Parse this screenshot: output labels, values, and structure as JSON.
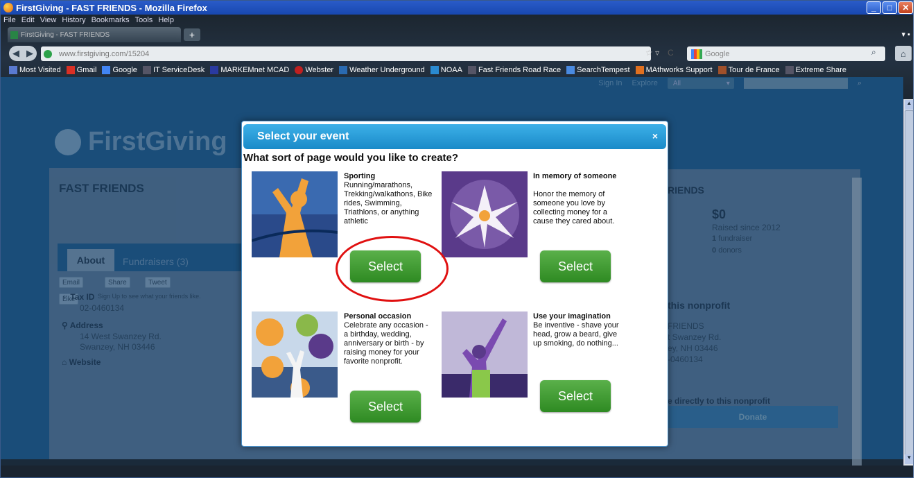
{
  "window": {
    "title": "FirstGiving - FAST FRIENDS - Mozilla Firefox"
  },
  "menu": [
    "File",
    "Edit",
    "View",
    "History",
    "Bookmarks",
    "Tools",
    "Help"
  ],
  "tab": {
    "title": "FirstGiving - FAST FRIENDS"
  },
  "nav": {
    "url_domain": "www.firstgiving.com",
    "url_path": "/15204",
    "search_placeholder": "Google"
  },
  "bookmarks": [
    "Most Visited",
    "Gmail",
    "Google",
    "IT ServiceDesk",
    "MARKEMnet MCAD",
    "Webster",
    "Weather Underground",
    "NOAA",
    "Fast Friends Road Race",
    "SearchTempest",
    "MAthworks Support",
    "Tour de France",
    "Extreme Share"
  ],
  "site": {
    "topnav": {
      "signin": "Sign In",
      "explore": "Explore",
      "all": "All"
    },
    "logo": "FirstGiving",
    "org_title": "FAST FRIENDS",
    "share": {
      "email": "Email",
      "share": "Share",
      "tweet": "Tweet",
      "like": "Like",
      "signup": "Sign Up to see what your friends like."
    },
    "tabs": {
      "about": "About",
      "fundraisers": "Fundraisers (3)"
    },
    "tax_id_label": "Tax ID",
    "tax_id": "02-0460134",
    "address_label": "Address",
    "address_line1": "14 West Swanzey Rd.",
    "address_line2": "Swanzey, NH 03446",
    "website_label": "Website",
    "right": {
      "heading": "RIENDS",
      "amount": "$0",
      "raised": "Raised since 2012",
      "fundraisers_count": "1",
      "fundraisers_label": "fundraiser",
      "donors_count": "0",
      "donors_label": "donors",
      "nonprofit_heading": "this nonprofit",
      "np_name": "FRIENDS",
      "np_addr1": "t Swanzey Rd.",
      "np_addr2": "ey, NH 03446",
      "np_tax": "-0460134",
      "donate_text": "e directly to this nonprofit",
      "donate_button": "Donate"
    }
  },
  "modal": {
    "title": "Select your event",
    "close": "×",
    "question": "What sort of page would you like to create?",
    "options": [
      {
        "title": "Sporting",
        "desc": "Running/marathons, Trekking/walkathons, Bike rides, Swimming, Triathlons, or anything athletic",
        "button": "Select"
      },
      {
        "title": "In memory of someone",
        "desc": "Honor the memory of someone you love by collecting money for a cause they cared about.",
        "button": "Select"
      },
      {
        "title": "Personal occasion",
        "desc": "Celebrate any occasion - a birthday, wedding, anniversary or birth - by raising money for your favorite nonprofit.",
        "button": "Select"
      },
      {
        "title": "Use your imagination",
        "desc": "Be inventive - shave your head, grow a beard, give up smoking, do nothing...",
        "button": "Select"
      }
    ]
  }
}
